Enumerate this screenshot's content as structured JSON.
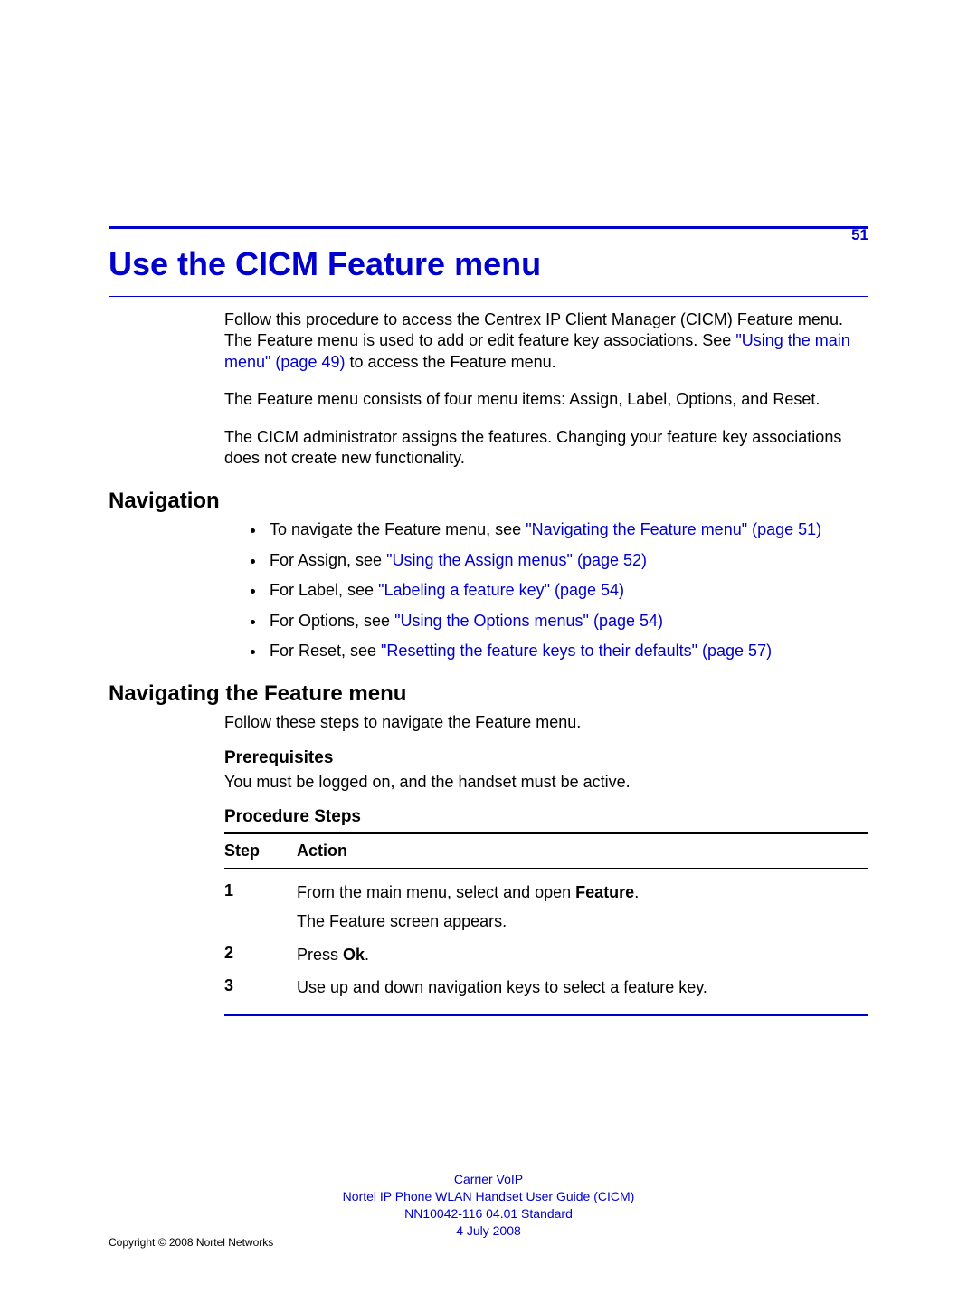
{
  "page_number": "51",
  "title": "Use the CICM Feature menu",
  "intro": {
    "p1_a": "Follow this procedure to access the Centrex IP Client Manager (CICM) Feature menu. The Feature menu is used to add or edit feature key associations. See ",
    "p1_link": "\"Using the main menu\" (page 49)",
    "p1_b": " to access the Feature menu.",
    "p2": "The Feature menu consists of four menu items: Assign, Label, Options, and Reset.",
    "p3": "The CICM administrator assigns the features. Changing your feature key associations does not create new functionality."
  },
  "nav_heading": "Navigation",
  "nav_items": [
    {
      "pre": "To navigate the Feature menu, see ",
      "link": "\"Navigating the Feature menu\" (page 51)",
      "post": ""
    },
    {
      "pre": "For Assign, see ",
      "link": "\"Using the Assign menus\" (page 52)",
      "post": ""
    },
    {
      "pre": "For Label, see ",
      "link": "\"Labeling a feature key\" (page 54)",
      "post": ""
    },
    {
      "pre": "For Options, see ",
      "link": "\"Using the Options menus\" (page 54)",
      "post": ""
    },
    {
      "pre": "For Reset, see ",
      "link": "\"Resetting the feature keys to their defaults\" (page 57)",
      "post": ""
    }
  ],
  "navmenu_heading": "Navigating the Feature menu",
  "navmenu_intro": "Follow these steps to navigate the Feature menu.",
  "prereq_heading": "Prerequisites",
  "prereq_text": "You must be logged on, and the handset must be active.",
  "procsteps_heading": "Procedure Steps",
  "table": {
    "step_label": "Step",
    "action_label": "Action",
    "rows": [
      {
        "num": "1",
        "line1a": "From the main menu, select and open ",
        "line1b_bold": "Feature",
        "line1c": ".",
        "line2": "The Feature screen appears."
      },
      {
        "num": "2",
        "line1a": "Press ",
        "line1b_bold": "Ok",
        "line1c": ".",
        "line2": ""
      },
      {
        "num": "3",
        "line1a": "Use up and down navigation keys to select a feature key.",
        "line1b_bold": "",
        "line1c": "",
        "line2": ""
      }
    ]
  },
  "footer": {
    "l1": "Carrier VoIP",
    "l2": "Nortel IP Phone WLAN Handset User Guide (CICM)",
    "l3": "NN10042-116   04.01   Standard",
    "l4": "4 July 2008"
  },
  "copyright": "Copyright © 2008 Nortel Networks"
}
